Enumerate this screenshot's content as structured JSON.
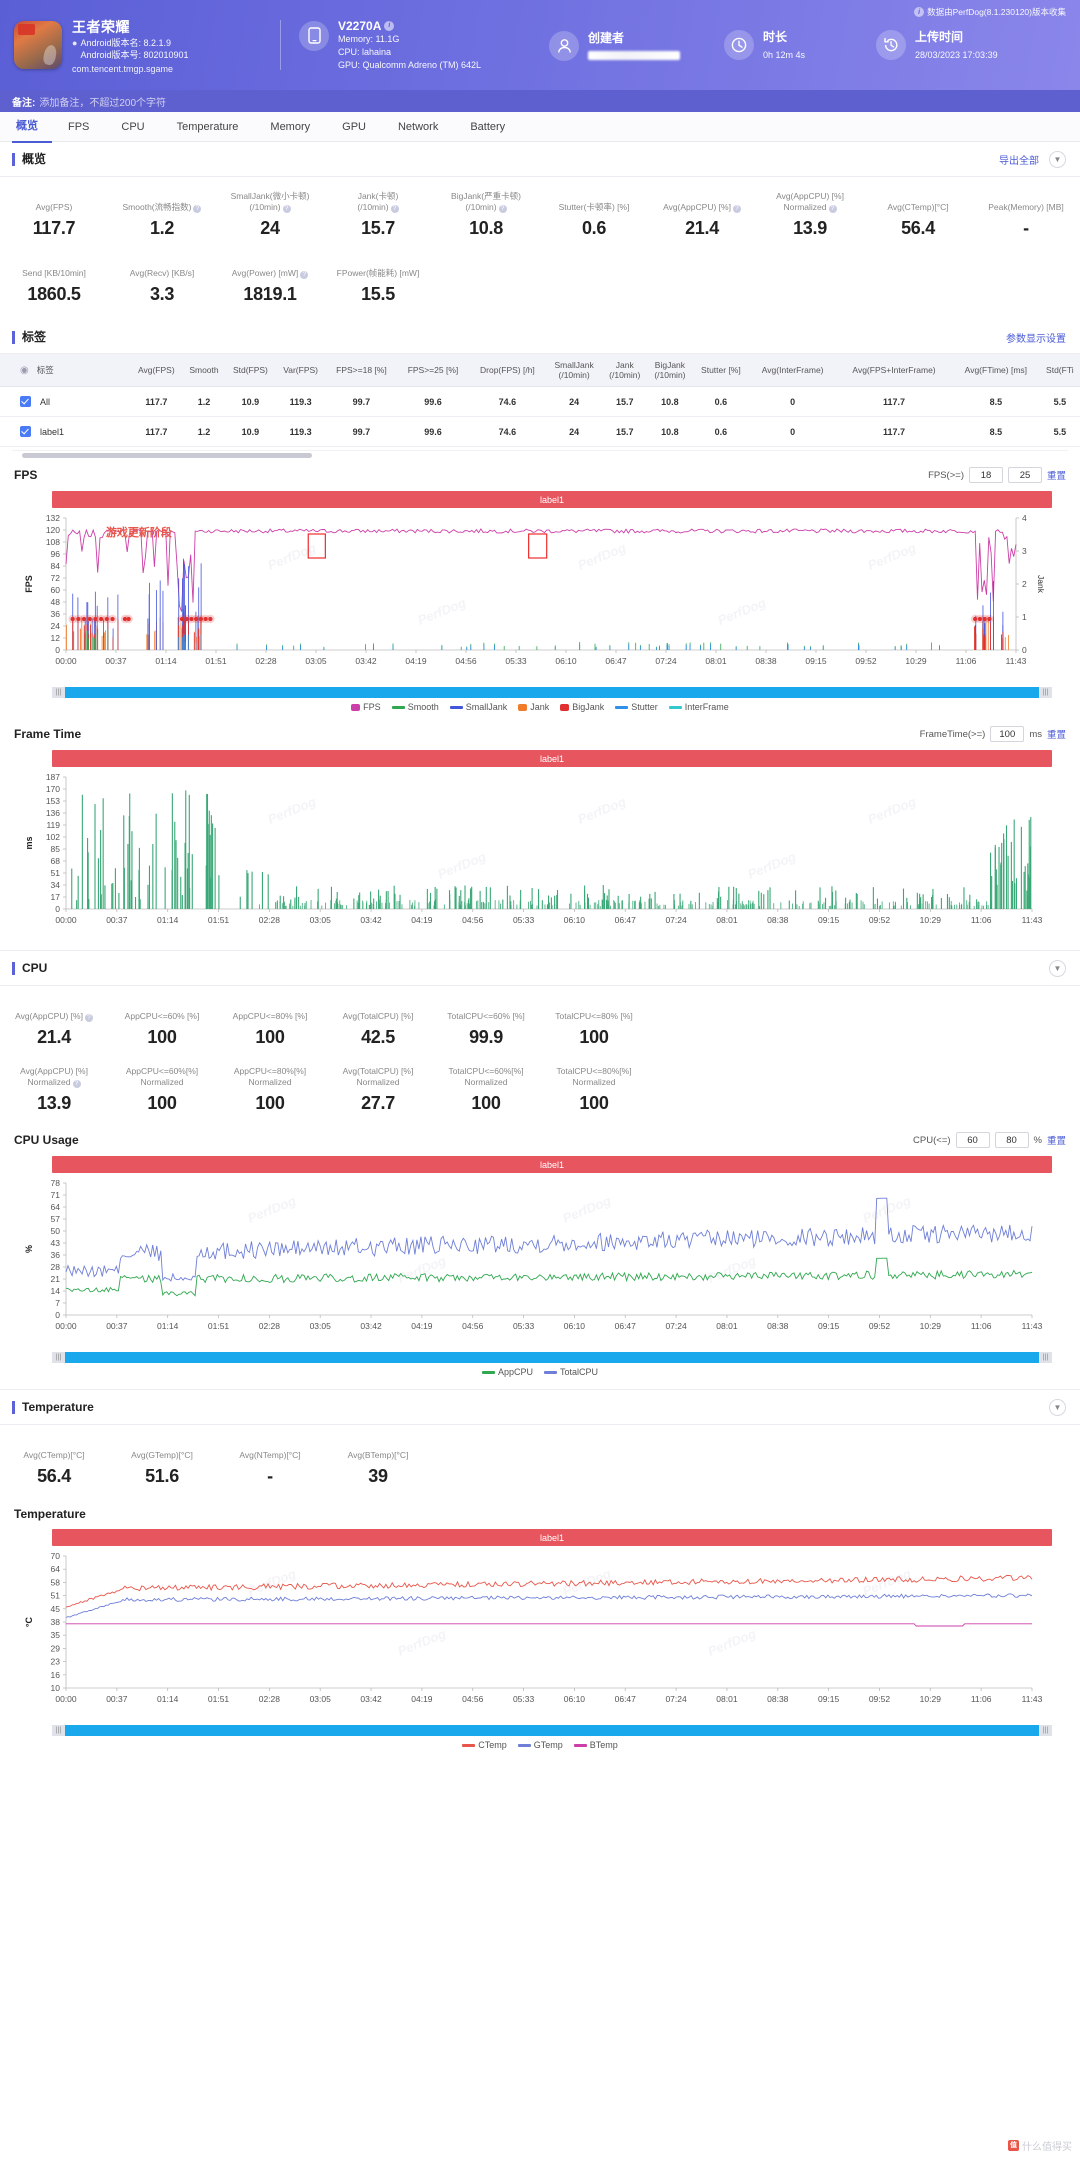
{
  "header": {
    "app_name": "王者荣耀",
    "android_version_name": "Android版本名: 8.2.1.9",
    "android_version_code": "Android版本号: 802010901",
    "package": "com.tencent.tmgp.sgame",
    "device_model": "V2270A",
    "memory": "Memory: 11.1G",
    "cpu": "CPU: lahaina",
    "gpu": "GPU: Qualcomm Adreno (TM) 642L",
    "creator_label": "创建者",
    "duration_label": "时长",
    "duration_value": "0h 12m 4s",
    "upload_label": "上传时间",
    "upload_value": "28/03/2023 17:03:39",
    "perfdog_note": "数据由PerfDog(8.1.230120)版本收集",
    "remark_label": "备注:",
    "remark_placeholder": "添加备注，不超过200个字符",
    "accent": "#5b5fd6"
  },
  "tabs": [
    {
      "label": "概览",
      "active": true
    },
    {
      "label": "FPS",
      "active": false
    },
    {
      "label": "CPU",
      "active": false
    },
    {
      "label": "Temperature",
      "active": false
    },
    {
      "label": "Memory",
      "active": false
    },
    {
      "label": "GPU",
      "active": false
    },
    {
      "label": "Network",
      "active": false
    },
    {
      "label": "Battery",
      "active": false
    }
  ],
  "overview": {
    "title": "概览",
    "export_label": "导出全部",
    "stats_row1": [
      {
        "label": "Avg(FPS)",
        "value": "117.7",
        "help": false
      },
      {
        "label": "Smooth(流畅指数)",
        "value": "1.2",
        "help": true
      },
      {
        "label": "SmallJank(微小卡顿)\n(/10min)",
        "value": "24",
        "help": true
      },
      {
        "label": "Jank(卡顿)\n(/10min)",
        "value": "15.7",
        "help": true
      },
      {
        "label": "BigJank(严重卡顿)\n(/10min)",
        "value": "10.8",
        "help": true
      },
      {
        "label": "Stutter(卡顿率) [%]",
        "value": "0.6",
        "help": false
      },
      {
        "label": "Avg(AppCPU) [%]",
        "value": "21.4",
        "help": true
      },
      {
        "label": "Avg(AppCPU) [%]\nNormalized",
        "value": "13.9",
        "help": true
      },
      {
        "label": "Avg(CTemp)[°C]",
        "value": "56.4",
        "help": false
      },
      {
        "label": "Peak(Memory) [MB]",
        "value": "-",
        "help": false
      }
    ],
    "stats_row2": [
      {
        "label": "Send [KB/10min]",
        "value": "1860.5",
        "help": false
      },
      {
        "label": "Avg(Recv) [KB/s]",
        "value": "3.3",
        "help": false
      },
      {
        "label": "Avg(Power) [mW]",
        "value": "1819.1",
        "help": true
      },
      {
        "label": "FPower(帧能耗) [mW]",
        "value": "15.5",
        "help": false
      }
    ]
  },
  "tags": {
    "title": "标签",
    "settings_link": "参数显示设置",
    "columns": [
      "标签",
      "Avg(FPS)",
      "Smooth",
      "Std(FPS)",
      "Var(FPS)",
      "FPS>=18 [%]",
      "FPS>=25 [%]",
      "Drop(FPS) [/h]",
      "SmallJank\n(/10min)",
      "Jank\n(/10min)",
      "BigJank\n(/10min)",
      "Stutter [%]",
      "Avg(InterFrame)",
      "Avg(FPS+InterFrame)",
      "Avg(FTime) [ms]",
      "Std(FTi"
    ],
    "rows": [
      {
        "name": "All",
        "checked": true,
        "values": [
          "117.7",
          "1.2",
          "10.9",
          "119.3",
          "99.7",
          "99.6",
          "74.6",
          "24",
          "15.7",
          "10.8",
          "0.6",
          "0",
          "117.7",
          "8.5",
          "5.5"
        ]
      },
      {
        "name": "label1",
        "checked": true,
        "values": [
          "117.7",
          "1.2",
          "10.9",
          "119.3",
          "99.7",
          "99.6",
          "74.6",
          "24",
          "15.7",
          "10.8",
          "0.6",
          "0",
          "117.7",
          "8.5",
          "5.5"
        ]
      }
    ]
  },
  "fps_section": {
    "title": "FPS",
    "ctrl_label": "FPS(>=)",
    "ctrl_v1": "18",
    "ctrl_v2": "25",
    "reset": "重置",
    "label_bar": "label1",
    "annotation": "游戏更新阶段",
    "legend": [
      {
        "name": "FPS",
        "color": "#cc3fa8"
      },
      {
        "name": "Smooth",
        "color": "#2fa84f"
      },
      {
        "name": "SmallJank",
        "color": "#4455dd"
      },
      {
        "name": "Jank",
        "color": "#f07c2a"
      },
      {
        "name": "BigJank",
        "color": "#e03030"
      },
      {
        "name": "Stutter",
        "color": "#2e90e8"
      },
      {
        "name": "InterFrame",
        "color": "#33c9cc"
      }
    ]
  },
  "frametime_section": {
    "title": "Frame Time",
    "ctrl_label": "FrameTime(>=)",
    "ctrl_v1": "100",
    "unit": "ms",
    "reset": "重置",
    "label_bar": "label1"
  },
  "cpu_section": {
    "title": "CPU",
    "stats_row1": [
      {
        "label": "Avg(AppCPU) [%]",
        "value": "21.4",
        "help": true
      },
      {
        "label": "AppCPU<=60% [%]",
        "value": "100",
        "help": false
      },
      {
        "label": "AppCPU<=80% [%]",
        "value": "100",
        "help": false
      },
      {
        "label": "Avg(TotalCPU) [%]",
        "value": "42.5",
        "help": false
      },
      {
        "label": "TotalCPU<=60% [%]",
        "value": "99.9",
        "help": false
      },
      {
        "label": "TotalCPU<=80% [%]",
        "value": "100",
        "help": false
      }
    ],
    "stats_row2": [
      {
        "label": "Avg(AppCPU) [%]\nNormalized",
        "value": "13.9",
        "help": true
      },
      {
        "label": "AppCPU<=60%[%]\nNormalized",
        "value": "100",
        "help": false
      },
      {
        "label": "AppCPU<=80%[%]\nNormalized",
        "value": "100",
        "help": false
      },
      {
        "label": "Avg(TotalCPU) [%]\nNormalized",
        "value": "27.7",
        "help": false
      },
      {
        "label": "TotalCPU<=60%[%]\nNormalized",
        "value": "100",
        "help": false
      },
      {
        "label": "TotalCPU<=80%[%]\nNormalized",
        "value": "100",
        "help": false
      }
    ],
    "chart_title": "CPU Usage",
    "ctrl_label": "CPU(<=)",
    "ctrl_v1": "60",
    "ctrl_v2": "80",
    "unit": "%",
    "reset": "重置",
    "label_bar": "label1",
    "legend": [
      {
        "name": "AppCPU",
        "color": "#2fa84f"
      },
      {
        "name": "TotalCPU",
        "color": "#6f7fd8"
      }
    ]
  },
  "temp_section": {
    "title": "Temperature",
    "stats_row1": [
      {
        "label": "Avg(CTemp)[°C]",
        "value": "56.4",
        "help": false
      },
      {
        "label": "Avg(GTemp)[°C]",
        "value": "51.6",
        "help": false
      },
      {
        "label": "Avg(NTemp)[°C]",
        "value": "-",
        "help": false
      },
      {
        "label": "Avg(BTemp)[°C]",
        "value": "39",
        "help": false
      }
    ],
    "chart_title": "Temperature",
    "label_bar": "label1",
    "legend": [
      {
        "name": "CTemp",
        "color": "#e8564a"
      },
      {
        "name": "GTemp",
        "color": "#6f7fd8"
      },
      {
        "name": "BTemp",
        "color": "#cc3fa8"
      }
    ]
  },
  "chart_data": {
    "type": "line",
    "charts": [
      {
        "id": "fps",
        "title": "FPS",
        "ylabel": "FPS",
        "y2label": "Jank",
        "yticks": [
          0,
          12,
          24,
          36,
          48,
          60,
          72,
          84,
          96,
          108,
          120,
          132
        ],
        "ylim": [
          0,
          132
        ],
        "y2ticks": [
          0,
          1,
          2,
          3,
          4
        ],
        "y2lim": [
          0,
          4
        ],
        "xticks": [
          "00:00",
          "00:37",
          "01:14",
          "01:51",
          "02:28",
          "03:05",
          "03:42",
          "04:19",
          "04:56",
          "05:33",
          "06:10",
          "06:47",
          "07:24",
          "08:01",
          "08:38",
          "09:15",
          "09:52",
          "10:29",
          "11:06",
          "11:43"
        ],
        "series": [
          {
            "name": "FPS",
            "color": "#cc3fa8",
            "note": "steady ~118-120 across run with dips to 60-85 in first 90s and near 11:30"
          },
          {
            "name": "Smooth",
            "color": "#2fa84f"
          },
          {
            "name": "SmallJank",
            "color": "#4455dd"
          },
          {
            "name": "Jank",
            "color": "#f07c2a"
          },
          {
            "name": "BigJank",
            "color": "#e03030"
          },
          {
            "name": "Stutter",
            "color": "#2e90e8"
          },
          {
            "name": "InterFrame",
            "color": "#33c9cc"
          }
        ]
      },
      {
        "id": "frametime",
        "title": "Frame Time",
        "ylabel": "ms",
        "yticks": [
          0,
          17,
          34,
          51,
          68,
          85,
          102,
          119,
          136,
          153,
          170,
          187
        ],
        "ylim": [
          0,
          187
        ],
        "xticks": [
          "00:00",
          "00:37",
          "01:14",
          "01:51",
          "02:28",
          "03:05",
          "03:42",
          "04:19",
          "04:56",
          "05:33",
          "06:10",
          "06:47",
          "07:24",
          "08:01",
          "08:38",
          "09:15",
          "09:52",
          "10:29",
          "11:06",
          "11:43"
        ],
        "series": [
          {
            "name": "FrameTime",
            "color": "#3aa876"
          }
        ]
      },
      {
        "id": "cpu",
        "title": "CPU Usage",
        "ylabel": "%",
        "yticks": [
          0,
          7,
          14,
          21,
          28,
          36,
          43,
          50,
          57,
          64,
          71,
          78
        ],
        "ylim": [
          0,
          78
        ],
        "xticks": [
          "00:00",
          "00:37",
          "01:14",
          "01:51",
          "02:28",
          "03:05",
          "03:42",
          "04:19",
          "04:56",
          "05:33",
          "06:10",
          "06:47",
          "07:24",
          "08:01",
          "08:38",
          "09:15",
          "09:52",
          "10:29",
          "11:06",
          "11:43"
        ],
        "series": [
          {
            "name": "AppCPU",
            "color": "#2fa84f",
            "avg": 21.4
          },
          {
            "name": "TotalCPU",
            "color": "#6f7fd8",
            "avg": 42.5
          }
        ]
      },
      {
        "id": "temperature",
        "title": "Temperature",
        "ylabel": "°C",
        "yticks": [
          10,
          16,
          23,
          29,
          35,
          38,
          45,
          51,
          58,
          64,
          70
        ],
        "ylim": [
          10,
          70
        ],
        "xticks": [
          "00:00",
          "00:37",
          "01:14",
          "01:51",
          "02:28",
          "03:05",
          "03:42",
          "04:19",
          "04:56",
          "05:33",
          "06:10",
          "06:47",
          "07:24",
          "08:01",
          "08:38",
          "09:15",
          "09:52",
          "10:29",
          "11:06",
          "11:43"
        ],
        "series": [
          {
            "name": "CTemp",
            "color": "#e8564a",
            "avg": 56.4
          },
          {
            "name": "GTemp",
            "color": "#6f7fd8",
            "avg": 51.6
          },
          {
            "name": "BTemp",
            "color": "#cc3fa8",
            "avg": 39
          }
        ]
      }
    ]
  },
  "footer_brand": "什么值得买"
}
